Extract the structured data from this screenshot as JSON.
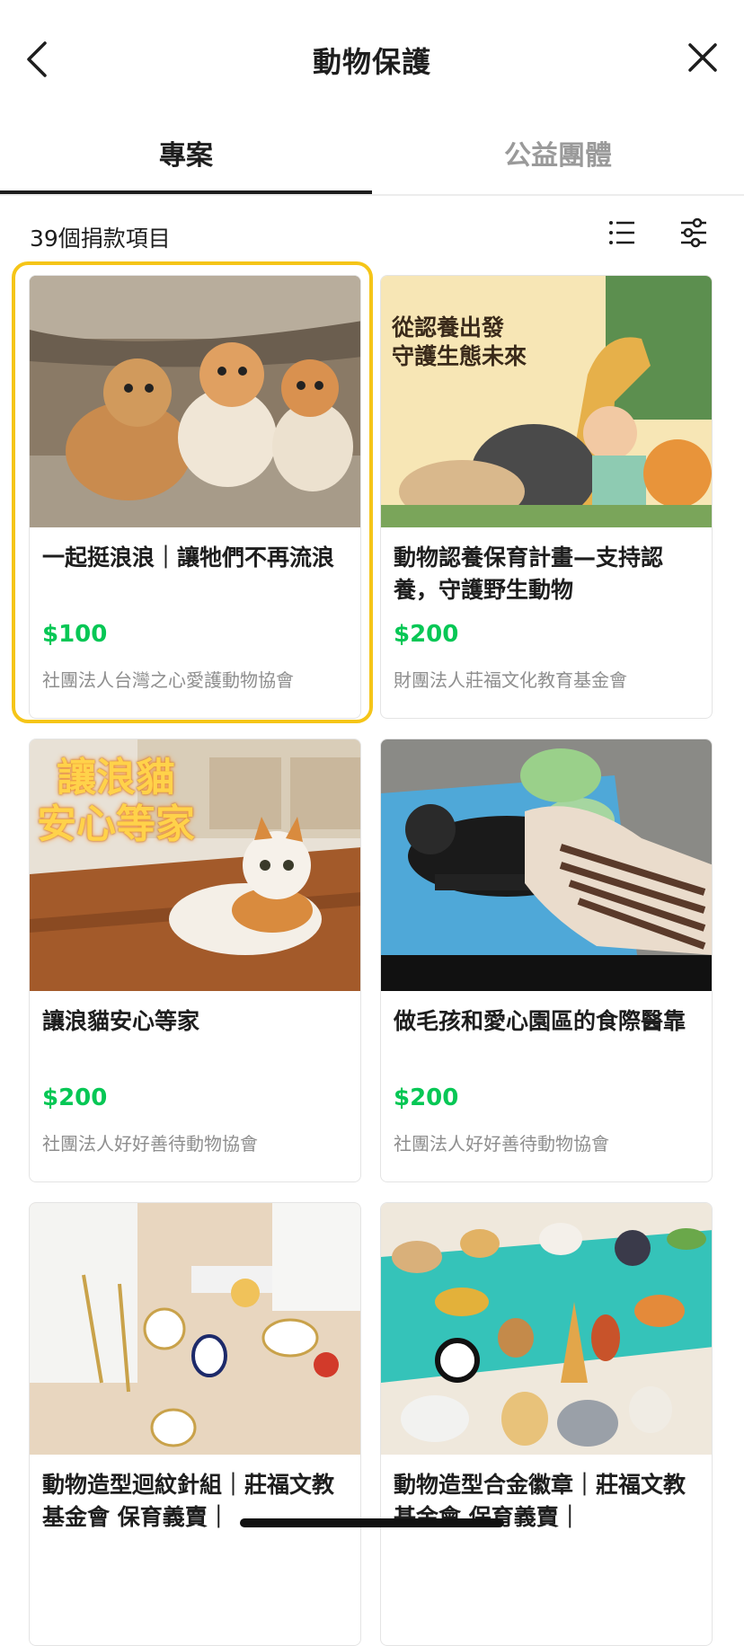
{
  "header": {
    "title": "動物保護",
    "back_icon": "chevron-left-icon",
    "close_icon": "close-icon"
  },
  "tabs": [
    {
      "label": "專案",
      "active": true
    },
    {
      "label": "公益團體",
      "active": false
    }
  ],
  "summary": {
    "count_label": "39個捐款項目",
    "list_icon": "list-view-icon",
    "filter_icon": "filter-sliders-icon"
  },
  "colors": {
    "price": "#06c755",
    "focus": "#f5c518",
    "text": "#1e1e1e",
    "muted": "#8e8e8e"
  },
  "projects": [
    {
      "title": "一起挺浪浪｜讓牠們不再流浪",
      "price": "$100",
      "org": "社團法人台灣之心愛護動物協會",
      "image": "kittens-photo"
    },
    {
      "title": "動物認養保育計畫—支持認養，守護野生動物",
      "price": "$200",
      "org": "財團法人莊福文化教育基金會",
      "image": "wildlife-illustration",
      "image_text": {
        "line1": "從認養出發",
        "line2": "守護生態未來"
      }
    },
    {
      "title": "讓浪貓安心等家",
      "price": "$200",
      "org": "社團法人好好善待動物協會",
      "image": "cat-photo",
      "image_text": {
        "line1": "讓浪貓",
        "line2": "安心等家"
      }
    },
    {
      "title": "做毛孩和愛心園區的食際醫靠",
      "price": "$200",
      "org": "社團法人好好善待動物協會",
      "image": "dog-care-photo"
    },
    {
      "title": "動物造型迴紋針組｜莊福文教基金會 保育義賣｜",
      "price": "",
      "org": "",
      "image": "paperclips-photo"
    },
    {
      "title": "動物造型合金徽章｜莊福文教基金會 保育義賣｜",
      "price": "",
      "org": "",
      "image": "pins-photo"
    }
  ]
}
